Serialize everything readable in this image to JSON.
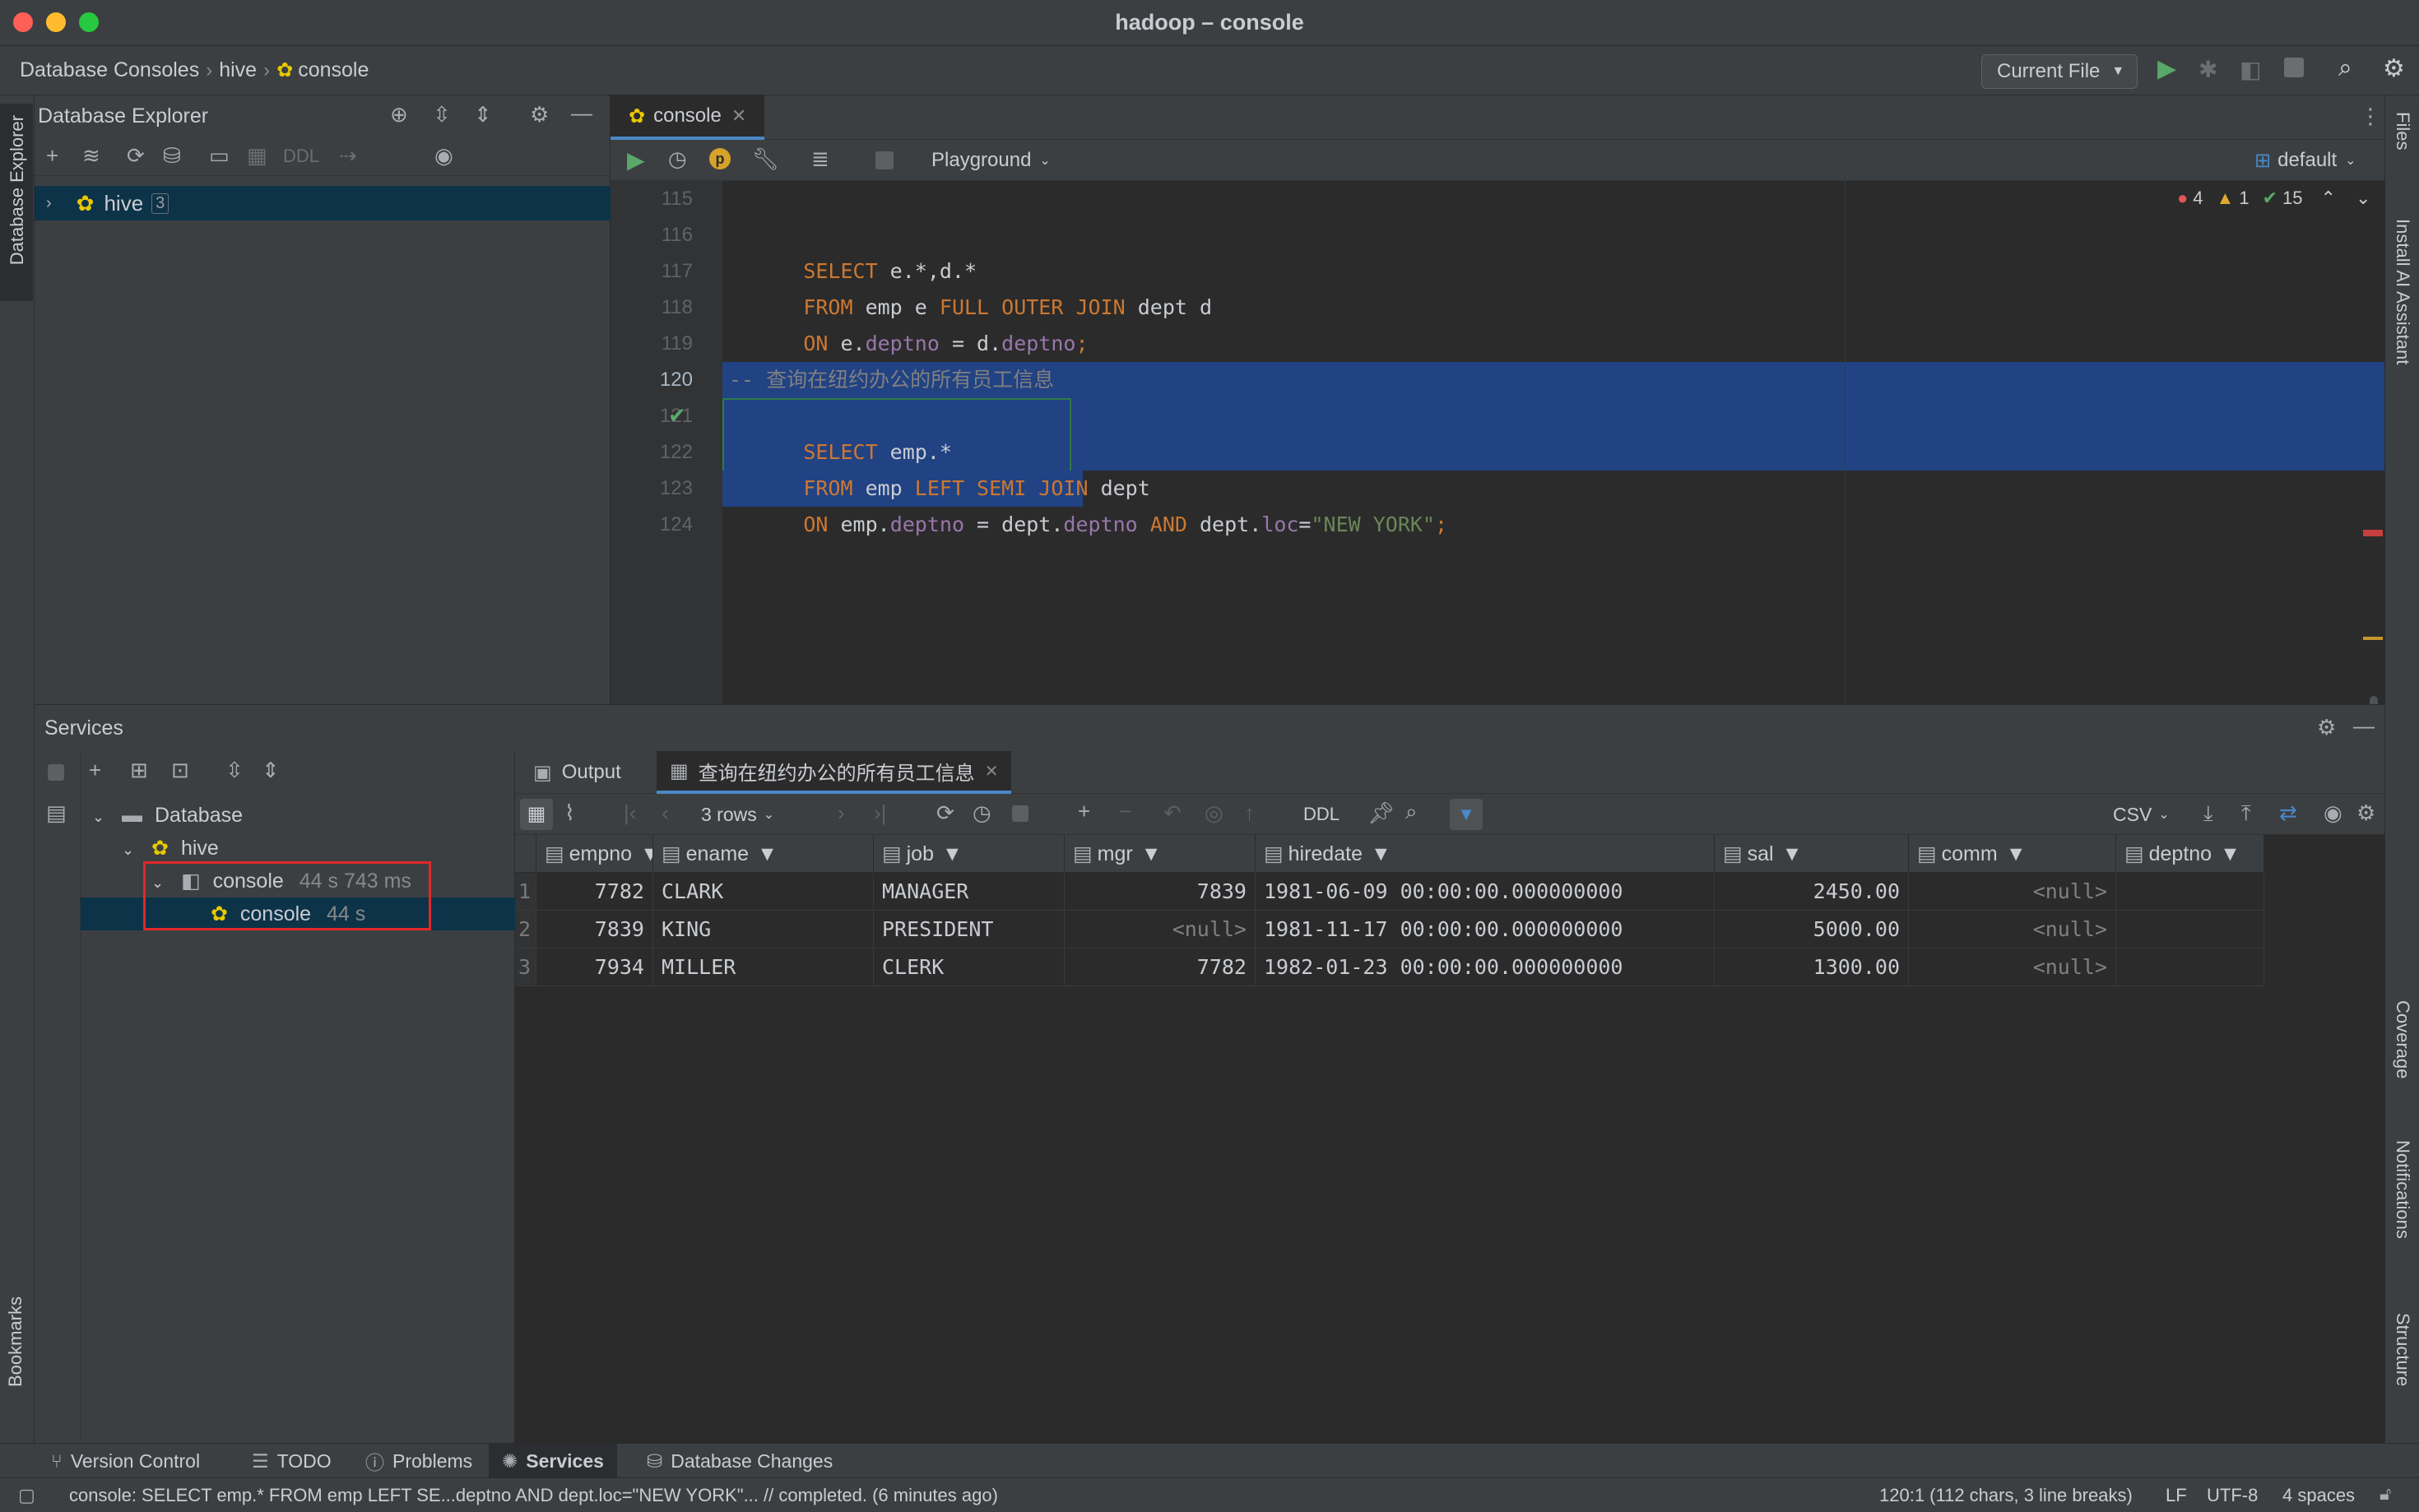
{
  "window": {
    "title": "hadoop – console"
  },
  "breadcrumb": [
    "Database Consoles",
    "hive",
    "console"
  ],
  "run_config": "Current File",
  "db_explorer": {
    "title": "Database Explorer",
    "toolbar_ddl": "DDL",
    "tree": [
      {
        "label": "hive",
        "badge": "3"
      }
    ]
  },
  "left_stripe": {
    "top_label": "Database Explorer",
    "bottom_label": "Bookmarks"
  },
  "right_stripe": {
    "labels": [
      "Files",
      "Install AI Assistant",
      "Coverage",
      "Notifications",
      "Structure"
    ]
  },
  "editor": {
    "tab_label": "console",
    "playground_label": "Playground",
    "schema_label": "default",
    "inspections": {
      "errors": "4",
      "warnings": "1",
      "ok": "15"
    },
    "lines": [
      {
        "num": "115",
        "text": ""
      },
      {
        "num": "116",
        "text": "SELECT e.*,d.*"
      },
      {
        "num": "117",
        "text": "FROM emp e FULL OUTER JOIN dept d"
      },
      {
        "num": "118",
        "text": "ON e.deptno = d.deptno;"
      },
      {
        "num": "119",
        "text": ""
      },
      {
        "num": "120",
        "text": "-- 查询在纽约办公的所有员工信息"
      },
      {
        "num": "121",
        "text": "SELECT emp.*"
      },
      {
        "num": "122",
        "text": "FROM emp LEFT SEMI JOIN dept"
      },
      {
        "num": "123",
        "text": "ON emp.deptno = dept.deptno AND dept.loc=\"NEW YORK\";"
      },
      {
        "num": "124",
        "text": ""
      }
    ],
    "code_tokens": {
      "l116": [
        "SELECT",
        " e.*,d.*"
      ],
      "l117": [
        "FROM",
        " emp e ",
        "FULL OUTER JOIN",
        " dept d"
      ],
      "l118": [
        "ON",
        " e.",
        "deptno",
        " = d.",
        "deptno",
        ";"
      ],
      "l120": "-- 查询在纽约办公的所有员工信息",
      "l121": [
        "SELECT",
        " emp.*"
      ],
      "l122": [
        "FROM",
        " emp ",
        "LEFT SEMI JOIN",
        " dept"
      ],
      "l123": [
        "ON",
        " emp.",
        "deptno",
        " = dept.",
        "deptno",
        " ",
        "AND",
        " dept.",
        "loc",
        "=",
        "\"NEW YORK\"",
        ";"
      ]
    }
  },
  "services": {
    "title": "Services",
    "tree": {
      "database": "Database",
      "hive": "hive",
      "console_label": "console",
      "console_time": "44 s 743 ms",
      "child_label": "console",
      "child_time": "44 s"
    },
    "tabs": [
      "Output",
      "查询在纽约办公的所有员工信息"
    ],
    "rows_label": "3 rows",
    "ddl_label": "DDL",
    "export_label": "CSV",
    "columns": [
      "empno",
      "ename",
      "job",
      "mgr",
      "hiredate",
      "sal",
      "comm",
      "deptno"
    ],
    "rows": [
      {
        "n": "1",
        "empno": "7782",
        "ename": "CLARK",
        "job": "MANAGER",
        "mgr": "7839",
        "hiredate": "1981-06-09 00:00:00.000000000",
        "sal": "2450.00",
        "comm": "<null>"
      },
      {
        "n": "2",
        "empno": "7839",
        "ename": "KING",
        "job": "PRESIDENT",
        "mgr": "<null>",
        "hiredate": "1981-11-17 00:00:00.000000000",
        "sal": "5000.00",
        "comm": "<null>"
      },
      {
        "n": "3",
        "empno": "7934",
        "ename": "MILLER",
        "job": "CLERK",
        "mgr": "7782",
        "hiredate": "1982-01-23 00:00:00.000000000",
        "sal": "1300.00",
        "comm": "<null>"
      }
    ]
  },
  "tool_windows": [
    "Version Control",
    "TODO",
    "Problems",
    "Services",
    "Database Changes"
  ],
  "status": {
    "message": "console: SELECT emp.* FROM emp LEFT SE...deptno AND dept.loc=\"NEW YORK\"... // completed. (6 minutes ago)",
    "position": "120:1 (112 chars, 3 line breaks)",
    "line_sep": "LF",
    "encoding": "UTF-8",
    "indent": "4 spaces"
  },
  "colors": {
    "accent": "#4a88c7",
    "selection": "#214283",
    "keyword": "#cc7832",
    "field": "#9876aa",
    "string": "#6a8759",
    "highlight_box": "#e02828"
  }
}
